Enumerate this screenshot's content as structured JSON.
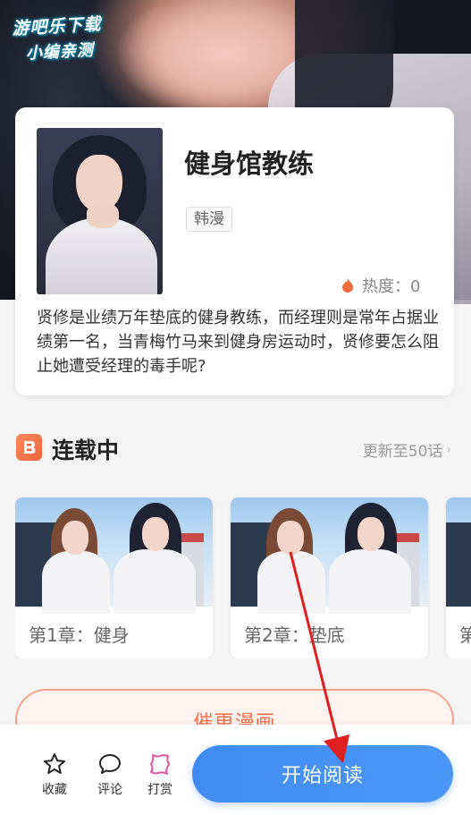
{
  "watermark": {
    "line1": "游吧乐下载",
    "line2": "小编亲测"
  },
  "comic": {
    "title": "健身馆教练",
    "tag": "韩漫",
    "heat_label": "热度：0",
    "description": "贤修是业绩万年垫底的健身教练，而经理则是常年占据业绩第一名，当青梅竹马来到健身房运动时，贤修要怎么阻止她遭受经理的毒手呢?"
  },
  "serial": {
    "title": "连载中",
    "update_text": "更新至50话",
    "chevron": "›",
    "chapters": [
      {
        "label": "第1章：健身"
      },
      {
        "label": "第2章：垫底"
      },
      {
        "label": "第"
      }
    ]
  },
  "urge_button": {
    "label": "催更漫画"
  },
  "bottom_bar": {
    "collect_label": "收藏",
    "comment_label": "评论",
    "reward_label": "打赏",
    "read_label": "开始阅读"
  },
  "colors": {
    "primary": "#3f8bf2",
    "accent_orange": "#f0643c",
    "reward_pink": "#e0569e",
    "annotation_red": "#e02020"
  },
  "icons": [
    "fire-icon",
    "serial-book-icon",
    "star-icon",
    "comment-icon",
    "reward-icon",
    "chevron-right-icon"
  ]
}
